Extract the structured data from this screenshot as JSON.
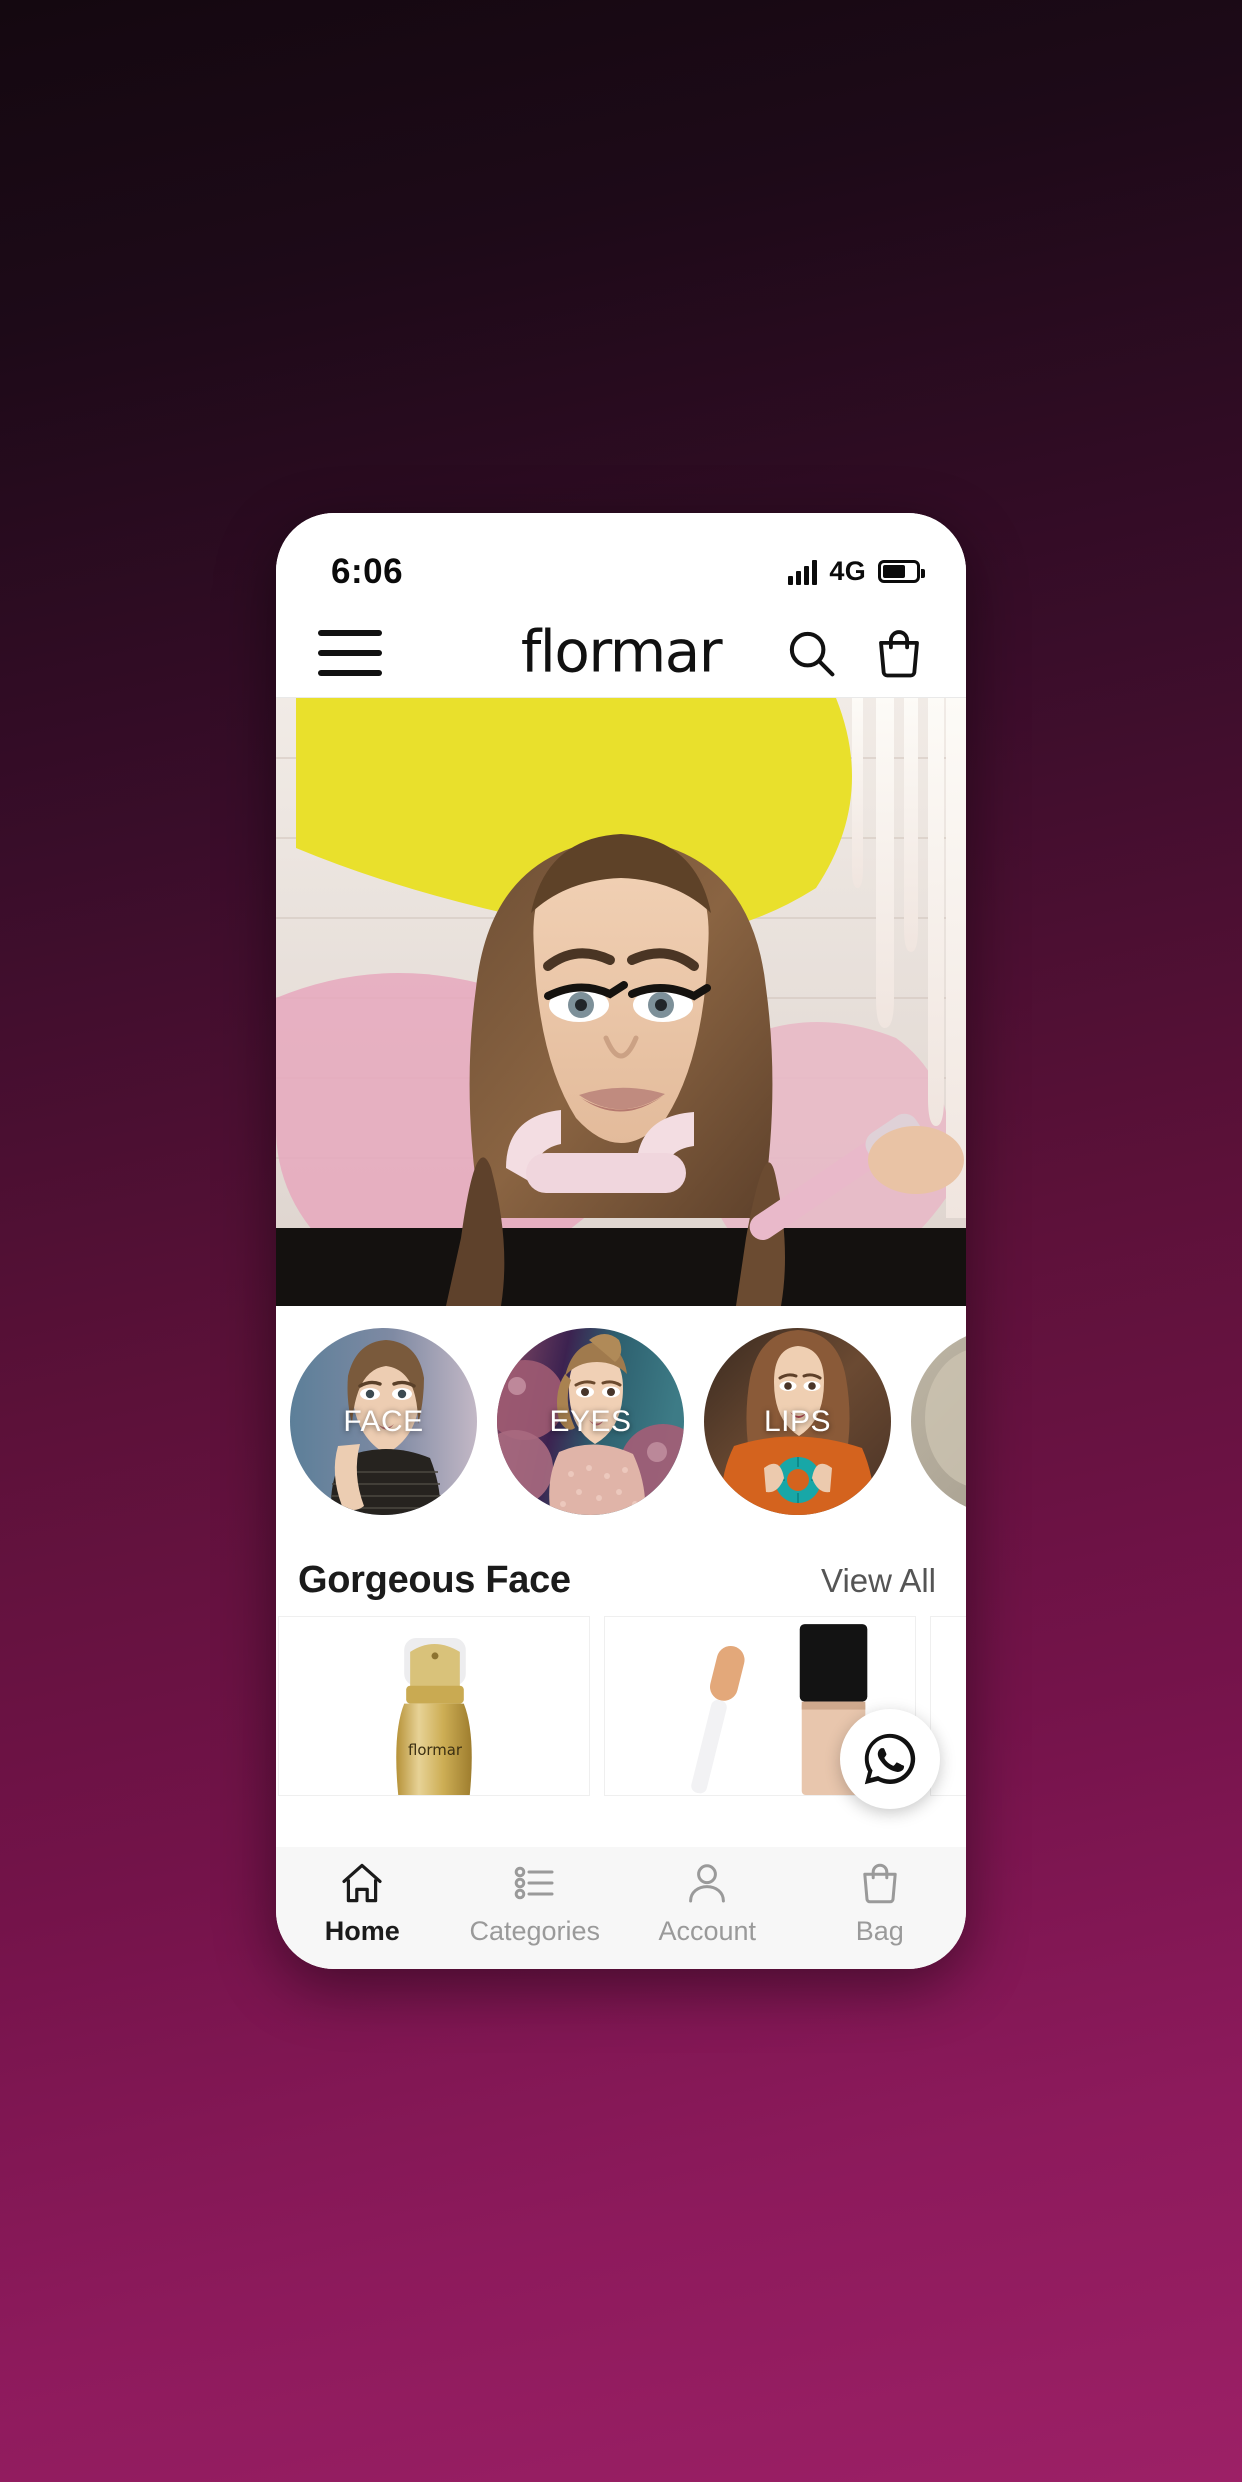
{
  "status_bar": {
    "time": "6:06",
    "network": "4G",
    "signal_icon": "signal-bars-icon",
    "battery_icon": "battery-icon",
    "battery_level": 62
  },
  "header": {
    "menu_icon": "hamburger-menu-icon",
    "brand": "flormar",
    "search_icon": "search-icon",
    "bag_icon": "shopping-bag-icon"
  },
  "hero": {
    "alt": "woman-with-makeup-banner",
    "accent_yellow": "#e8de2e",
    "accent_pink": "#e8b6c4"
  },
  "categories": [
    {
      "label": "FACE",
      "image": "face-category-thumbnail"
    },
    {
      "label": "EYES",
      "image": "eyes-category-thumbnail"
    },
    {
      "label": "LIPS",
      "image": "lips-category-thumbnail"
    },
    {
      "label": "",
      "image": "nails-category-thumbnail"
    }
  ],
  "section": {
    "title": "Gorgeous Face",
    "view_all": "View All"
  },
  "products": [
    {
      "image": "gold-foundation-bottle"
    },
    {
      "image": "lip-gloss-applicator"
    },
    {
      "image": "black-lipstick-tube"
    }
  ],
  "floating_action": {
    "icon": "whatsapp-icon",
    "color": "#111111"
  },
  "bottom_nav": [
    {
      "label": "Home",
      "icon": "home-icon",
      "active": true
    },
    {
      "label": "Categories",
      "icon": "list-icon",
      "active": false
    },
    {
      "label": "Account",
      "icon": "person-icon",
      "active": false
    },
    {
      "label": "Bag",
      "icon": "bag-icon",
      "active": false
    }
  ],
  "colors": {
    "page_background_top": "#140810",
    "page_background_bottom": "#9c2066",
    "nav_active": "#1b1b1b",
    "nav_inactive": "#9a9a9a"
  }
}
